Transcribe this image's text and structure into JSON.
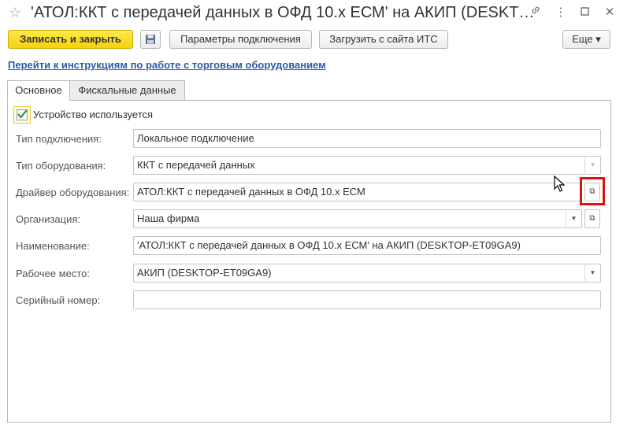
{
  "window": {
    "title": "'АТОЛ:ККТ с передачей данных в ОФД 10.x ЕСМ' на АКИП (DESKT…",
    "star_icon": "☆",
    "link_icon": "🔗",
    "more_icon": "⋮",
    "maximize_icon": "☐",
    "close_icon": "✕"
  },
  "toolbar": {
    "save_close_label": "Записать и закрыть",
    "save_icon": "💾",
    "connection_params_label": "Параметры подключения",
    "download_its_label": "Загрузить с сайта ИТС",
    "more_label": "Еще ▾"
  },
  "instructions_link": "Перейти к инструкциям по работе с торговым оборудованием",
  "tabs": [
    {
      "label": "Основное",
      "active": true
    },
    {
      "label": "Фискальные данные",
      "active": false
    }
  ],
  "form": {
    "device_used": {
      "label": "Устройство используется",
      "checked": true
    },
    "connection_type": {
      "label": "Тип подключения:",
      "value": "Локальное подключение"
    },
    "equipment_type": {
      "label": "Тип оборудования:",
      "value": "ККТ с передачей данных"
    },
    "equipment_driver": {
      "label": "Драйвер оборудования:",
      "value": "АТОЛ:ККТ с передачей данных в ОФД 10.x ЕСМ"
    },
    "organization": {
      "label": "Организация:",
      "value": "Наша фирма"
    },
    "name": {
      "label": "Наименование:",
      "value": "'АТОЛ:ККТ с передачей данных в ОФД 10.x ЕСМ' на АКИП (DESKTOP-ET09GA9)"
    },
    "workplace": {
      "label": "Рабочее место:",
      "value": "АКИП (DESKTOP-ET09GA9)"
    },
    "serial_number": {
      "label": "Серийный номер:",
      "value": ""
    }
  },
  "icons": {
    "dropdown": "▼",
    "open": "⧉",
    "checkmark": "✔"
  },
  "colors": {
    "primary_button": "#f5d20b",
    "link": "#2a5aa7",
    "highlight": "#e01010",
    "check": "#2e9b3f"
  }
}
